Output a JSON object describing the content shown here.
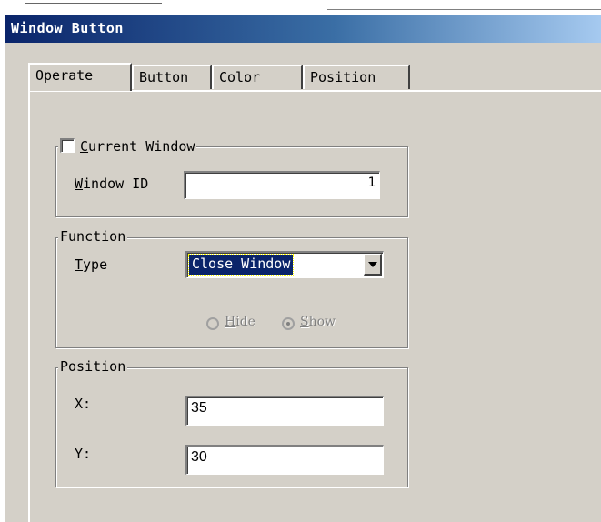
{
  "window": {
    "title": "Window Button"
  },
  "tabs": [
    "Operate",
    "Button",
    "Color",
    "Position"
  ],
  "current_window_group": {
    "checkbox_label_hotkey": "C",
    "checkbox_label_rest": "urrent Window",
    "checked": false,
    "window_id_label_hotkey": "W",
    "window_id_label_rest": "indow ID",
    "window_id_value": "1"
  },
  "function_group": {
    "legend": "Function",
    "type_label_hotkey": "T",
    "type_label_rest": "ype",
    "type_value": "Close Window",
    "radio_hide_hotkey": "H",
    "radio_hide_rest": "ide",
    "radio_show_hotkey": "S",
    "radio_show_rest": "how",
    "selected_radio": "Show"
  },
  "position_group": {
    "legend": "Position",
    "x_label": "X:",
    "x_value": "35",
    "y_label": "Y:",
    "y_value": "30"
  }
}
